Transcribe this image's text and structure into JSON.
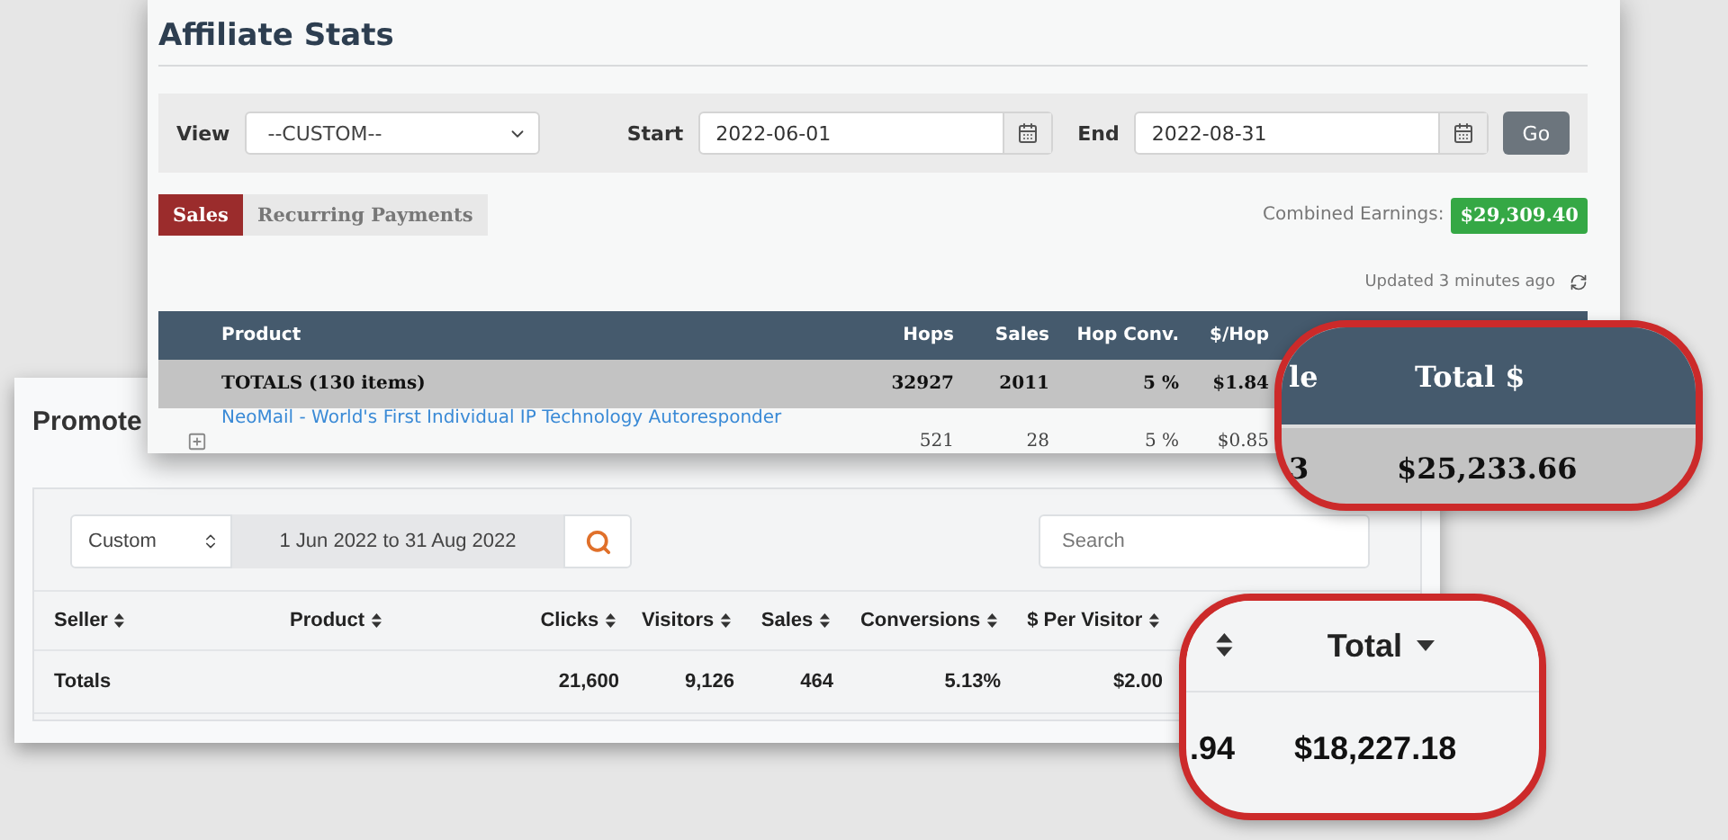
{
  "affiliate_stats": {
    "title": "Affiliate Stats",
    "view": {
      "label": "View",
      "value": "--CUSTOM--"
    },
    "start": {
      "label": "Start",
      "value": "2022-06-01"
    },
    "end": {
      "label": "End",
      "value": "2022-08-31"
    },
    "go_button": "Go",
    "tabs": [
      {
        "label": "Sales",
        "selected": true
      },
      {
        "label": "Recurring Payments",
        "selected": false
      }
    ],
    "combined_earnings": {
      "label": "Combined Earnings:",
      "value": "$29,309.40"
    },
    "updated": "Updated 3 minutes ago",
    "table": {
      "columns": [
        "Product",
        "Hops",
        "Sales",
        "Hop Conv.",
        "$/Hop"
      ],
      "totals": [
        "TOTALS (130 items)",
        "32927",
        "2011",
        "5 %",
        "$1.84"
      ],
      "rows": [
        [
          "NeoMail - World's First Individual IP Technology Autoresponder",
          "521",
          "28",
          "5 %",
          "$0.85"
        ]
      ]
    }
  },
  "promote": {
    "title": "Promote",
    "range_select": "Custom",
    "date_range": "1 Jun 2022 to 31 Aug 2022",
    "search": {
      "placeholder": "Search"
    },
    "table": {
      "columns": [
        "Seller",
        "Product",
        "Clicks",
        "Visitors",
        "Sales",
        "Conversions",
        "$ Per Visitor"
      ],
      "totals": {
        "label": "Totals",
        "values": [
          "21,600",
          "9,126",
          "464",
          "5.13%",
          "$2.00"
        ]
      }
    }
  },
  "callouts": [
    {
      "kind": "dark-header",
      "header_cut": "le",
      "header": "Total $",
      "value_cut": "3",
      "value": "$25,233.66"
    },
    {
      "kind": "light-header",
      "header": "Total",
      "value_cut": ".94",
      "value": "$18,227.18"
    }
  ]
}
